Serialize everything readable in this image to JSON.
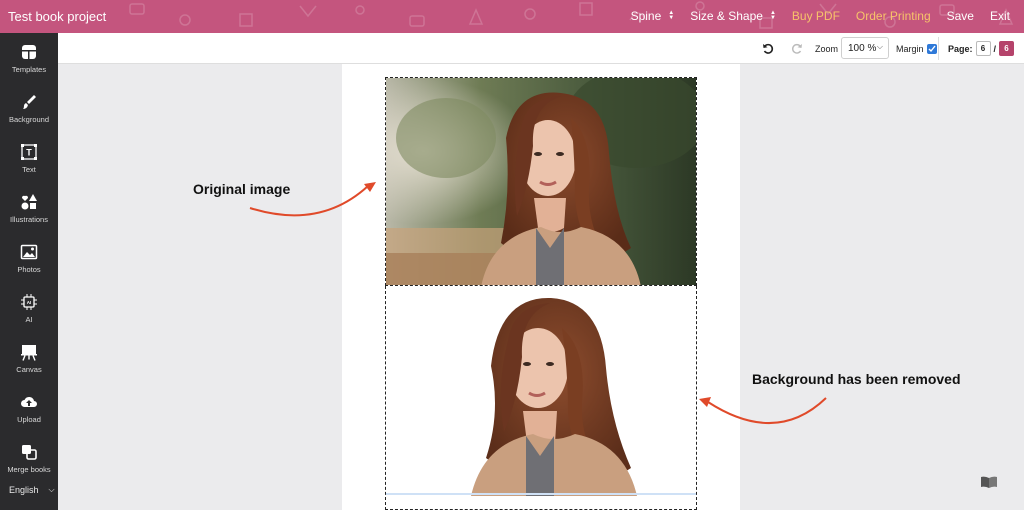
{
  "app": {
    "project_title": "Test book project"
  },
  "topnav": {
    "spine": "Spine",
    "size_shape": "Size & Shape",
    "buy_pdf": "Buy PDF",
    "order_printing": "Order Printing",
    "save": "Save",
    "exit": "Exit"
  },
  "sidebar": {
    "items": [
      {
        "label": "Templates",
        "icon": "templates-icon"
      },
      {
        "label": "Background",
        "icon": "paint-brush-icon"
      },
      {
        "label": "Text",
        "icon": "text-icon"
      },
      {
        "label": "Illustrations",
        "icon": "shapes-icon"
      },
      {
        "label": "Photos",
        "icon": "image-icon"
      },
      {
        "label": "AI",
        "icon": "ai-chip-icon"
      },
      {
        "label": "Canvas",
        "icon": "easel-icon"
      },
      {
        "label": "Upload",
        "icon": "cloud-upload-icon"
      },
      {
        "label": "Merge books",
        "icon": "merge-icon"
      }
    ],
    "language": "English"
  },
  "toolbar": {
    "zoom_label": "Zoom",
    "zoom_value": "100 %",
    "margin_label": "Margin",
    "margin_checked": true,
    "page_label": "Page:",
    "page_current": "6",
    "page_separator": "/",
    "page_total": "6"
  },
  "annotations": {
    "original": "Original image",
    "removed": "Background has been removed"
  },
  "colors": {
    "topbar": "#c4557e",
    "accent_text": "#f7c36a",
    "sidebar": "#2b2b2d",
    "arrow": "#e04a2a",
    "page_total_badge": "#b5436b"
  }
}
